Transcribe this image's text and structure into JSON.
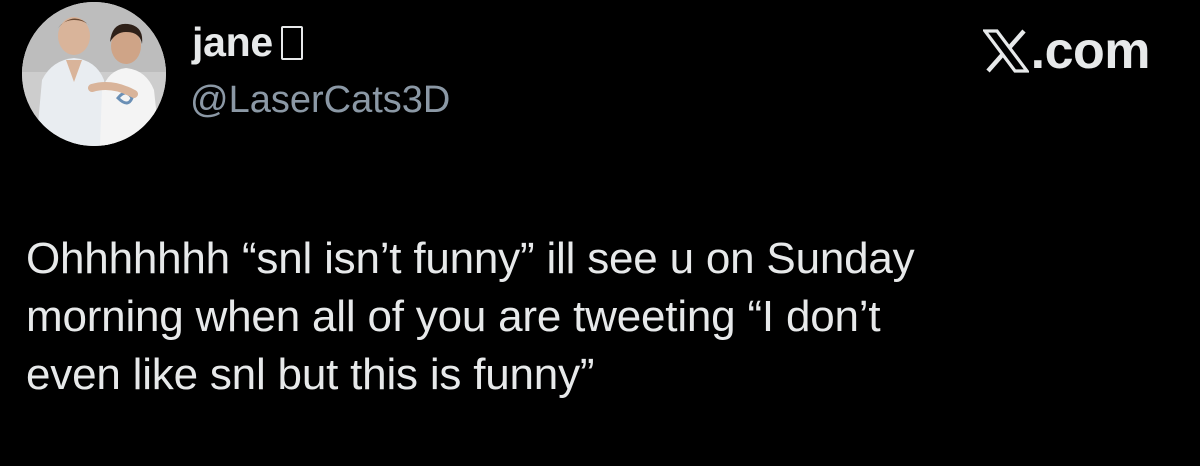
{
  "author": {
    "display_name": "jane",
    "handle": "@LaserCats3D",
    "avatar_icon": "profile-photo"
  },
  "brand": {
    "icon": "x-logo-icon",
    "text": ".com"
  },
  "tweet": {
    "lines": [
      "Ohhhhhhh “snl isn’t funny” ill see u on Sunday",
      "morning when all of you are tweeting “I don’t",
      "even like snl but this is funny”"
    ]
  },
  "colors": {
    "background": "#000000",
    "text_primary": "#e7e9ea",
    "text_secondary": "#8b98a5"
  }
}
